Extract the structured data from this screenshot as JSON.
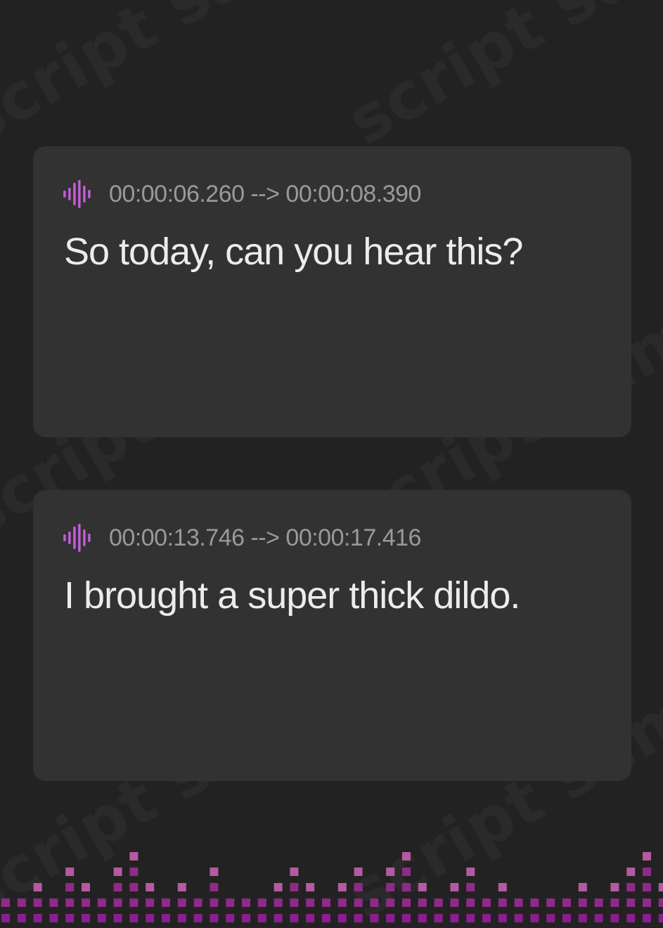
{
  "watermark": {
    "text": "script sample"
  },
  "entries": [
    {
      "icon": "audio-wave-icon",
      "timestamp": "00:00:06.260 --> 00:00:08.390",
      "text": "So today, can you hear this?"
    },
    {
      "icon": "audio-wave-icon",
      "timestamp": "00:00:13.746 --> 00:00:17.416",
      "text": "I brought a super thick dildo."
    }
  ],
  "colors": {
    "background": "#222222",
    "card": "#323232",
    "accent_start": "#a44dd6",
    "accent_end": "#e06ad0",
    "timestamp": "#9a9a9a",
    "subtitle": "#ececec",
    "equalizer_bottom": "#8a1e8f",
    "equalizer_mid": "#8f2a86",
    "equalizer_top": "#b55aa0"
  },
  "equalizer": {
    "icon": "equalizer-bars-decoration",
    "levels": [
      2,
      2,
      3,
      2,
      4,
      3,
      2,
      4,
      5,
      3,
      2,
      3,
      2,
      4,
      2,
      2,
      2,
      3,
      4,
      3,
      2,
      3,
      4,
      2,
      4,
      5,
      3,
      2,
      3,
      4,
      2,
      3,
      2,
      2,
      2,
      2,
      3,
      2,
      3,
      4,
      5,
      3,
      2,
      3,
      2,
      4,
      3,
      2,
      2,
      1,
      2
    ]
  }
}
